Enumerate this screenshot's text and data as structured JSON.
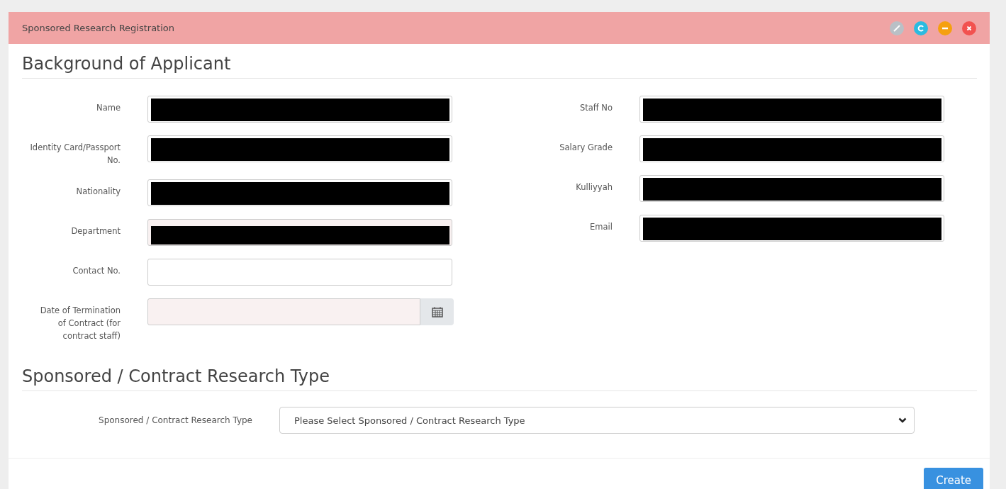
{
  "panel": {
    "title": "Sponsored Research Registration"
  },
  "sections": [
    {
      "heading": "Background of Applicant"
    },
    {
      "heading": "Sponsored / Contract Research Type"
    }
  ],
  "left_fields": [
    {
      "label": "Name",
      "redacted": true,
      "readonly": false,
      "kind": "text"
    },
    {
      "label": "Identity Card/Passport No.",
      "redacted": true,
      "readonly": false,
      "kind": "text"
    },
    {
      "label": "Nationality",
      "redacted": true,
      "readonly": false,
      "kind": "text"
    },
    {
      "label": "Department",
      "redacted": true,
      "readonly": true,
      "kind": "text"
    },
    {
      "label": "Contact No.",
      "redacted": false,
      "readonly": false,
      "kind": "text"
    },
    {
      "label": "Date of Termination of Contract (for contract staff)",
      "redacted": false,
      "readonly": true,
      "kind": "date"
    }
  ],
  "right_fields": [
    {
      "label": "Staff No",
      "redacted": true,
      "readonly": false
    },
    {
      "label": "Salary Grade",
      "redacted": true,
      "readonly": false
    },
    {
      "label": "Kulliyyah",
      "redacted": true,
      "readonly": false
    },
    {
      "label": "Email",
      "redacted": true,
      "readonly": false
    }
  ],
  "research_type": {
    "label": "Sponsored / Contract Research Type",
    "value": "Please Select Sponsored / Contract Research Type"
  },
  "buttons": [
    "Create"
  ]
}
